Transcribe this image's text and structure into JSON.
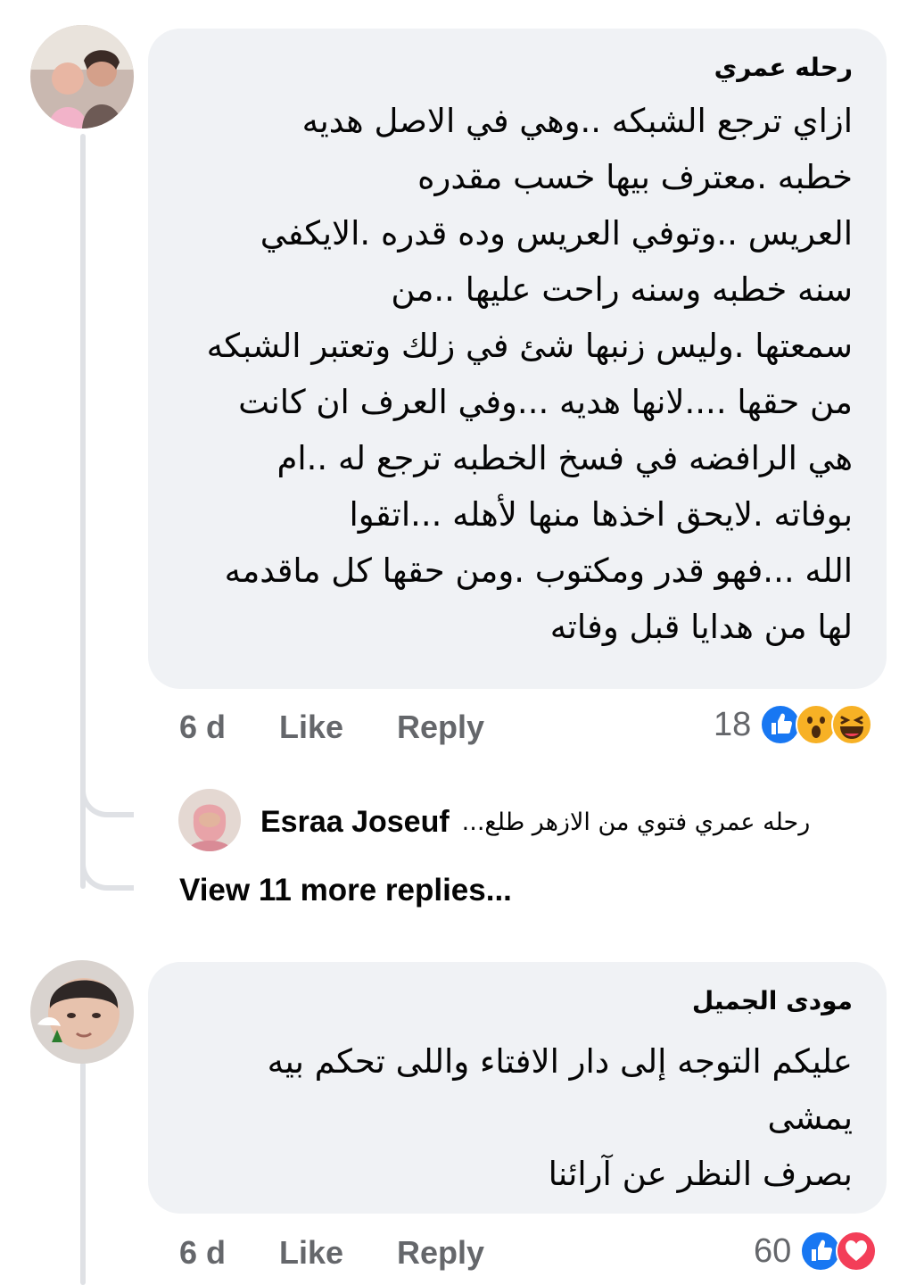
{
  "comments": [
    {
      "author": "رحله عمري",
      "text": "ازاي ترجع الشبكه ..وهي في الاصل هديه\nخطبه .معترف بيها خسب مقدره\nالعريس ..وتوفي العريس وده قدره .الايكفي\nسنه خطبه وسنه راحت عليها ..من\nسمعتها .وليس زنبها شئ في زلك وتعتبر الشبكه\nمن حقها ....لانها هديه ...وفي العرف ان كانت\nهي الرافضه في فسخ الخطبه ترجع له ..ام\nبوفاته .لايحق اخذها منها لأهله ...اتقوا\nالله ...فهو قدر ومكتوب .ومن حقها كل ماقدمه\nلها من هدايا قبل وفاته",
      "time": "6 d",
      "like_label": "Like",
      "reply_label": "Reply",
      "reaction_count": "18",
      "reaction_icons": [
        "like-icon",
        "wow-icon",
        "haha-icon"
      ],
      "reply_preview": {
        "name": "Esraa Joseuf",
        "snippet": "رحله عمري فتوي من الازهر طلع..."
      },
      "view_more": "View 11 more replies..."
    },
    {
      "author": "مودى الجميل",
      "text": "عليكم التوجه إلى دار الافتاء  واللى تحكم بيه\nيمشى\nبصرف النظر عن آرائنا",
      "time": "6 d",
      "like_label": "Like",
      "reply_label": "Reply",
      "reaction_count": "60",
      "reaction_icons": [
        "like-icon",
        "love-icon"
      ]
    }
  ],
  "colors": {
    "bubble": "#f0f2f5",
    "meta": "#65676b",
    "like_blue": "#1877f2",
    "love_red": "#f33e58",
    "emoji_yellow": "#f7b125"
  }
}
